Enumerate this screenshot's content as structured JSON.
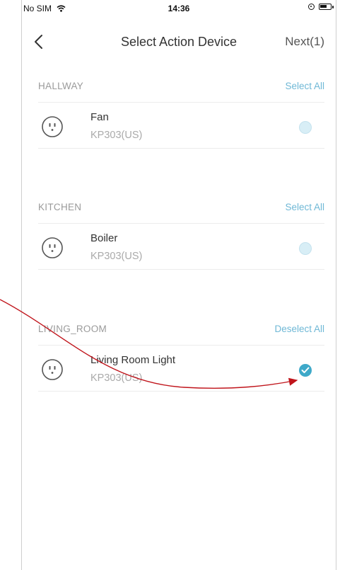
{
  "status": {
    "carrier": "No SIM",
    "time": "14:36"
  },
  "nav": {
    "title": "Select Action Device",
    "next_label": "Next(1)"
  },
  "rooms": [
    {
      "name": "HALLWAY",
      "action": "Select All",
      "device": {
        "name": "Fan",
        "model": "KP303(US)",
        "selected": false
      }
    },
    {
      "name": "KITCHEN",
      "action": "Select All",
      "device": {
        "name": "Boiler",
        "model": "KP303(US)",
        "selected": false
      }
    },
    {
      "name": "LIVING_ROOM",
      "action": "Deselect All",
      "device": {
        "name": "Living Room Light",
        "model": "KP303(US)",
        "selected": true
      }
    }
  ],
  "colors": {
    "accent": "#3ea9c9",
    "link": "#6fb8d6",
    "annotation_arrow": "#c0141b"
  },
  "icons": [
    "back-chevron-icon",
    "smart-plug-icon",
    "check-icon",
    "wifi-icon",
    "battery-icon"
  ]
}
